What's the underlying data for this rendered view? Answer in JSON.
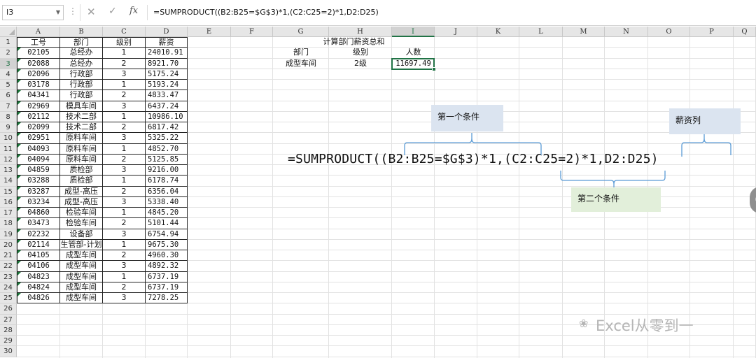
{
  "formula_bar": {
    "cell_ref": "I3",
    "fx_label": "fx",
    "formula": "=SUMPRODUCT((B2:B25=$G$3)*1,(C2:C25=2)*1,D2:D25)"
  },
  "columns": [
    "A",
    "B",
    "C",
    "D",
    "E",
    "F",
    "G",
    "H",
    "I",
    "J",
    "K",
    "L",
    "M",
    "N",
    "O",
    "P",
    "Q"
  ],
  "selected_column": "I",
  "selected_row": 3,
  "row_count": 30,
  "table": {
    "headers": [
      "工号",
      "部门",
      "级别",
      "薪资"
    ],
    "rows": [
      [
        "02105",
        "总经办",
        "1",
        "24010.91"
      ],
      [
        "02088",
        "总经办",
        "2",
        "8921.70"
      ],
      [
        "02096",
        "行政部",
        "3",
        "5175.24"
      ],
      [
        "03178",
        "行政部",
        "1",
        "5193.24"
      ],
      [
        "04341",
        "行政部",
        "2",
        "4833.47"
      ],
      [
        "02969",
        "模具车间",
        "3",
        "6437.24"
      ],
      [
        "02112",
        "技术二部",
        "1",
        "10986.10"
      ],
      [
        "02099",
        "技术二部",
        "2",
        "6817.42"
      ],
      [
        "02951",
        "原料车间",
        "3",
        "5325.22"
      ],
      [
        "04093",
        "原料车间",
        "1",
        "4852.70"
      ],
      [
        "04094",
        "原料车间",
        "2",
        "5125.85"
      ],
      [
        "04859",
        "质检部",
        "3",
        "9216.00"
      ],
      [
        "03288",
        "质检部",
        "1",
        "6178.74"
      ],
      [
        "03287",
        "成型-高压",
        "2",
        "6356.04"
      ],
      [
        "03234",
        "成型-高压",
        "3",
        "5338.40"
      ],
      [
        "04860",
        "检验车间",
        "1",
        "4845.20"
      ],
      [
        "03473",
        "检验车间",
        "2",
        "5101.44"
      ],
      [
        "02232",
        "设备部",
        "3",
        "6754.94"
      ],
      [
        "02114",
        "生管部-计划",
        "1",
        "9675.30"
      ],
      [
        "04105",
        "成型车间",
        "2",
        "4960.30"
      ],
      [
        "04106",
        "成型车间",
        "3",
        "4892.32"
      ],
      [
        "04823",
        "成型车间",
        "1",
        "6737.19"
      ],
      [
        "04824",
        "成型车间",
        "2",
        "6737.19"
      ],
      [
        "04826",
        "成型车间",
        "3",
        "7278.25"
      ]
    ]
  },
  "summary": {
    "title": "计算部门薪资总和",
    "header_dept": "部门",
    "header_level": "级别",
    "header_count": "人数",
    "dept_value": "成型车间",
    "level_value": "2级",
    "result_value": "11697.49"
  },
  "annotations": {
    "big_formula": "=SUMPRODUCT((B2:B25=$G$3)*1,(C2:C25=2)*1,D2:D25)",
    "condition1": "第一个条件",
    "condition2": "第二个条件",
    "salary_column": "薪资列"
  },
  "watermark": "Excel从零到一",
  "colors": {
    "excel_green": "#217346",
    "note_blue": "#dbe4f0",
    "note_green": "#e2efda",
    "brace_blue": "#5b9bd5"
  }
}
